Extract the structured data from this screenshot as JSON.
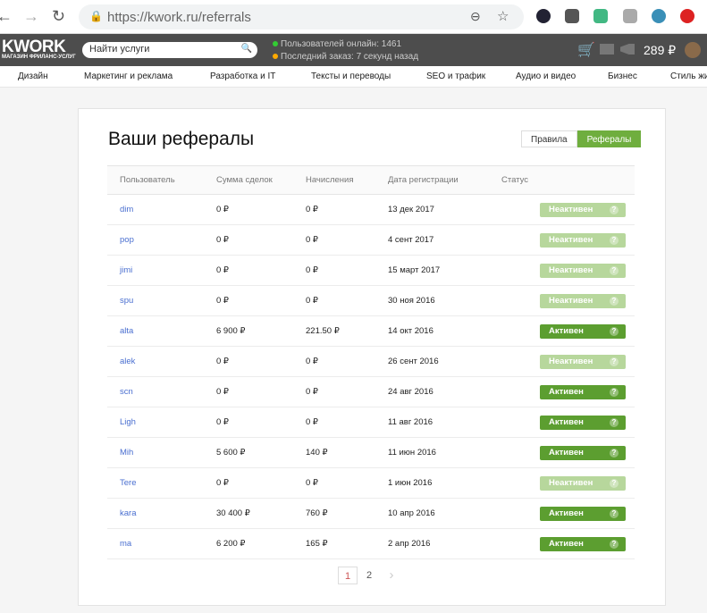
{
  "browser": {
    "url_host": "https://kwork.ru",
    "url_path": "/referrals"
  },
  "header": {
    "logo": "KWORK",
    "logo_sub": "МАГАЗИН ФРИЛАНС-УСЛУГ",
    "search_placeholder": "Найти услуги",
    "online": "Пользователей онлайн: 1461",
    "last_order": "Последний заказ: 7 секунд назад",
    "balance": "289 ₽"
  },
  "categories": [
    "Дизайн",
    "Маркетинг и реклама",
    "Разработка и IT",
    "Тексты и переводы",
    "SEO и трафик",
    "Аудио и видео",
    "Бизнес",
    "Стиль жи"
  ],
  "page": {
    "title": "Ваши рефералы",
    "tabs": [
      {
        "label": "Правила",
        "active": false
      },
      {
        "label": "Рефералы",
        "active": true
      }
    ]
  },
  "table": {
    "columns": [
      "Пользователь",
      "Сумма сделок",
      "Начисления",
      "Дата регистрации",
      "Статус"
    ],
    "rows": [
      [
        "dim",
        "0 ₽",
        "0 ₽",
        "13 дек 2017",
        "Неактивен"
      ],
      [
        "pop",
        "0 ₽",
        "0 ₽",
        "4 сент 2017",
        "Неактивен"
      ],
      [
        "jimi",
        "0 ₽",
        "0 ₽",
        "15 март 2017",
        "Неактивен"
      ],
      [
        "spu",
        "0 ₽",
        "0 ₽",
        "30 ноя 2016",
        "Неактивен"
      ],
      [
        "alta",
        "6 900 ₽",
        "221.50 ₽",
        "14 окт 2016",
        "Активен"
      ],
      [
        "alek",
        "0 ₽",
        "0 ₽",
        "26 сент 2016",
        "Неактивен"
      ],
      [
        "scn",
        "0 ₽",
        "0 ₽",
        "24 авг 2016",
        "Активен"
      ],
      [
        "Ligh",
        "0 ₽",
        "0 ₽",
        "11 авг 2016",
        "Активен"
      ],
      [
        "Mih",
        "5 600 ₽",
        "140 ₽",
        "11 июн 2016",
        "Активен"
      ],
      [
        "Tere",
        "0 ₽",
        "0 ₽",
        "1 июн 2016",
        "Неактивен"
      ],
      [
        "kara",
        "30 400 ₽",
        "760 ₽",
        "10 апр 2016",
        "Активен"
      ],
      [
        "ma",
        "6 200 ₽",
        "165 ₽",
        "2 апр 2016",
        "Активен"
      ]
    ],
    "help": "?"
  },
  "pagination": {
    "pages": [
      "1",
      "2"
    ],
    "current": "1",
    "next": "›"
  },
  "colors": {
    "active": "#5c9e30",
    "inactive": "#b7d79c",
    "header": "#4d4d4d"
  }
}
